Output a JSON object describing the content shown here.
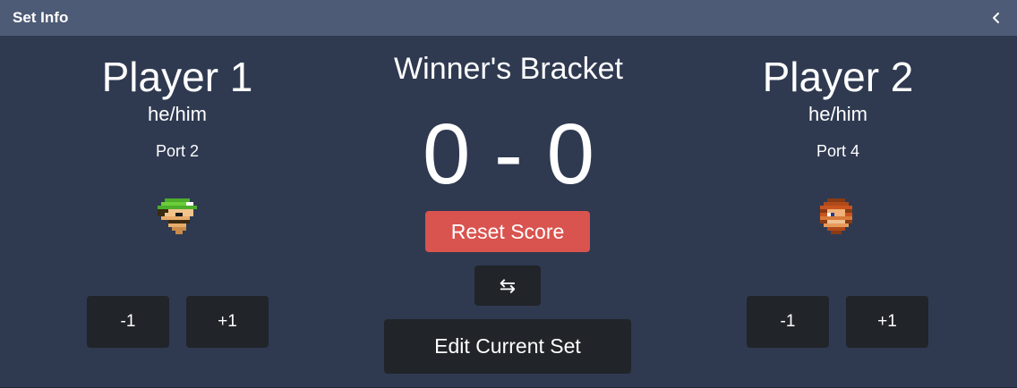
{
  "header": {
    "title": "Set Info",
    "collapse_icon": "chevron-left-icon"
  },
  "player1": {
    "name": "Player 1",
    "pronouns": "he/him",
    "port": "Port 2",
    "character_icon": "luigi-stock-icon",
    "minus_label": "-1",
    "plus_label": "+1"
  },
  "player2": {
    "name": "Player 2",
    "pronouns": "he/him",
    "port": "Port 4",
    "character_icon": "donkey-kong-stock-icon",
    "minus_label": "-1",
    "plus_label": "+1"
  },
  "center": {
    "bracket": "Winner's Bracket",
    "score": "0 - 0",
    "reset_label": "Reset Score",
    "swap_label": "⇆",
    "edit_label": "Edit Current Set"
  },
  "colors": {
    "panel_bg": "#2f3a51",
    "header_bg": "#4e5b76",
    "button_dark": "#212429",
    "reset_red": "#d9534f"
  }
}
